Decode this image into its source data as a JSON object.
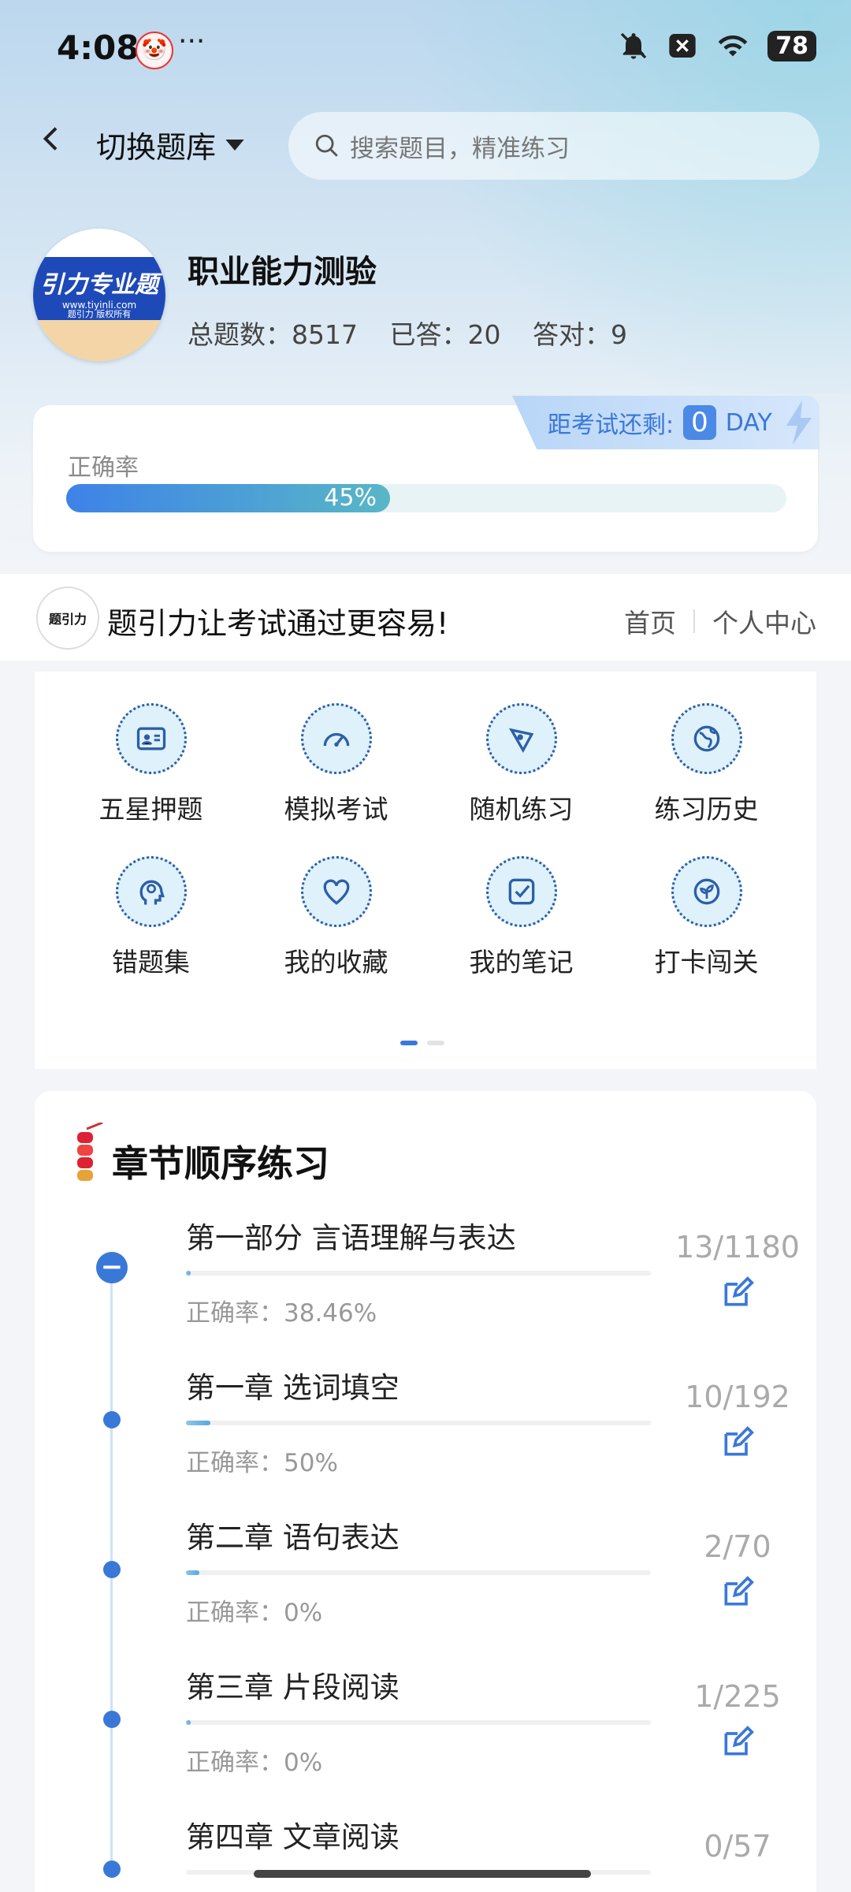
{
  "status_bar": {
    "time": "4:08",
    "dots": "···",
    "battery": "78"
  },
  "header": {
    "switch_label": "切换题库",
    "search_placeholder": "搜索题目，精准练习"
  },
  "bank": {
    "logo_text": "引力专业题",
    "logo_url": "www.tiyinli.com",
    "logo_rights": "题引力 版权所有",
    "title": "职业能力测验",
    "total": "总题数：8517",
    "answered": "已答：20",
    "correct": "答对：9"
  },
  "exam_countdown": {
    "prefix": "距考试还剩:",
    "days": "0",
    "unit": "DAY"
  },
  "accuracy": {
    "label": "正确率",
    "percent_text": "45%",
    "percent": 45
  },
  "banner": {
    "logo_text": "题引力",
    "slogan": "题引力让考试通过更容易!",
    "link_home": "首页",
    "link_profile": "个人中心"
  },
  "menu": [
    {
      "label": "五星押题",
      "icon": "id-card-icon"
    },
    {
      "label": "模拟考试",
      "icon": "speedometer-icon"
    },
    {
      "label": "随机练习",
      "icon": "network-icon"
    },
    {
      "label": "练习历史",
      "icon": "globe-icon"
    },
    {
      "label": "错题集",
      "icon": "brain-head-icon"
    },
    {
      "label": "我的收藏",
      "icon": "heart-icon"
    },
    {
      "label": "我的笔记",
      "icon": "note-check-icon"
    },
    {
      "label": "打卡闯关",
      "icon": "leaf-badge-icon"
    }
  ],
  "chapters": {
    "title": "章节顺序练习",
    "items": [
      {
        "name": "第一部分 言语理解与表达",
        "accuracy": "正确率：38.46%",
        "count": "13/1180",
        "progress": 0.011
      },
      {
        "name": "第一章 选词填空",
        "accuracy": "正确率：50%",
        "count": "10/192",
        "progress": 0.052
      },
      {
        "name": "第二章 语句表达",
        "accuracy": "正确率：0%",
        "count": "2/70",
        "progress": 0.029
      },
      {
        "name": "第三章 片段阅读",
        "accuracy": "正确率：0%",
        "count": "1/225",
        "progress": 0.004
      },
      {
        "name": "第四章 文章阅读",
        "accuracy": "",
        "count": "0/57",
        "progress": 0
      }
    ]
  }
}
